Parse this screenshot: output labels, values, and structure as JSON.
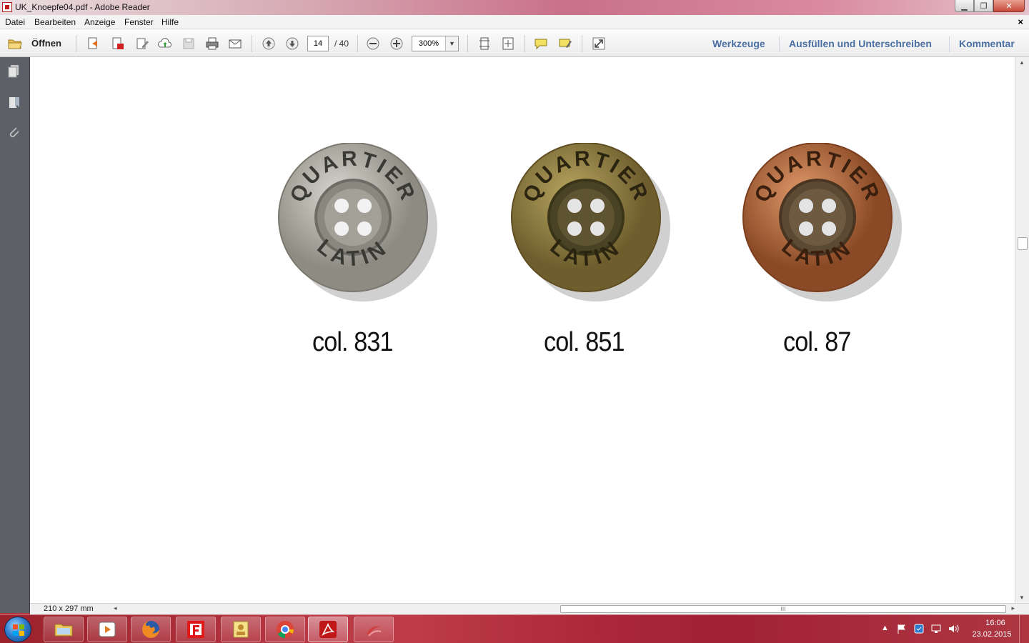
{
  "window": {
    "title": "UK_Knoepfe04.pdf - Adobe Reader",
    "controls": {
      "minimize": "▁",
      "maximize": "❐",
      "close": "✕"
    }
  },
  "menu": {
    "items": [
      "Datei",
      "Bearbeiten",
      "Anzeige",
      "Fenster",
      "Hilfe"
    ],
    "close_doc": "×"
  },
  "toolbar": {
    "open_label": "Öffnen",
    "page_current": "14",
    "page_total": "/ 40",
    "zoom": "300%",
    "zoom_arrow": "▼",
    "right_links": [
      "Werkzeuge",
      "Ausfüllen und Unterschreiben",
      "Kommentar"
    ]
  },
  "document": {
    "buttons": [
      {
        "caption": "col. 831",
        "text_top": "QUARTIER",
        "text_bottom": "LATIN",
        "face": "#9c9a90",
        "rim": "#c8c6bc",
        "center": "#7e7c72"
      },
      {
        "caption": "col. 851",
        "text_top": "QUARTIER",
        "text_bottom": "LATIN",
        "face": "#8c7a3c",
        "rim": "#b09c58",
        "center": "#5e5230"
      },
      {
        "caption": "col. 87",
        "text_top": "QUARTIER",
        "text_bottom": "LATIN",
        "face": "#b86a3e",
        "rim": "#d48a5a",
        "center": "#6e4a30"
      }
    ]
  },
  "status": {
    "page_size": "210 x 297 mm",
    "left_arrow": "◂",
    "right_arrow": "▸",
    "thumb_grip": "III"
  },
  "scrollbar": {
    "up": "▲",
    "down": "▼"
  },
  "taskbar": {
    "tray_arrow": "▲",
    "time": "16:06",
    "date": "23.02.2015"
  },
  "colors": {
    "accent_link": "#4a6fa3",
    "nav_pane": "#5d6067",
    "taskbar": "#b8323e"
  }
}
